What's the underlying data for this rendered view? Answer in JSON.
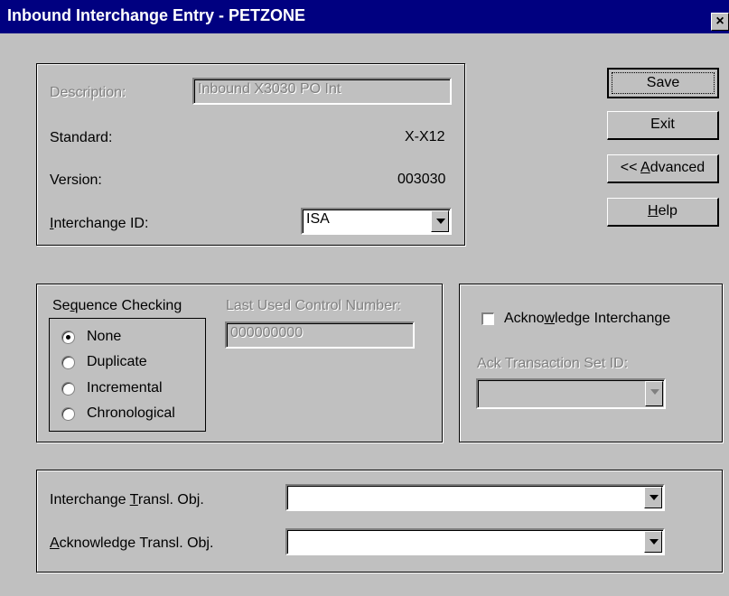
{
  "window": {
    "title": "Inbound Interchange Entry - PETZONE",
    "close": "×"
  },
  "info": {
    "description_label": "Description:",
    "description_value": "Inbound X3030 PO Int",
    "standard_label": "Standard:",
    "standard_value": "X-X12",
    "version_label": "Version:",
    "version_value": "003030",
    "interchange_id_label": "Interchange ID:",
    "interchange_id_value": "ISA"
  },
  "buttons": {
    "save": "Save",
    "exit": "Exit",
    "advanced": "<< Advanced",
    "help": "Help"
  },
  "sequence": {
    "heading": "Sequence Checking",
    "options": [
      "None",
      "Duplicate",
      "Incremental",
      "Chronological"
    ],
    "selected": "None",
    "last_used_label": "Last Used Control Number:",
    "last_used_value": "000000000"
  },
  "ack": {
    "checkbox_label": "Acknowledge Interchange",
    "checked": false,
    "set_id_label": "Ack Transaction Set ID:",
    "set_id_value": ""
  },
  "transl": {
    "interchange_label": "Interchange Transl. Obj.",
    "interchange_value": "",
    "ack_label": "Acknowledge Transl. Obj.",
    "ack_value": ""
  }
}
